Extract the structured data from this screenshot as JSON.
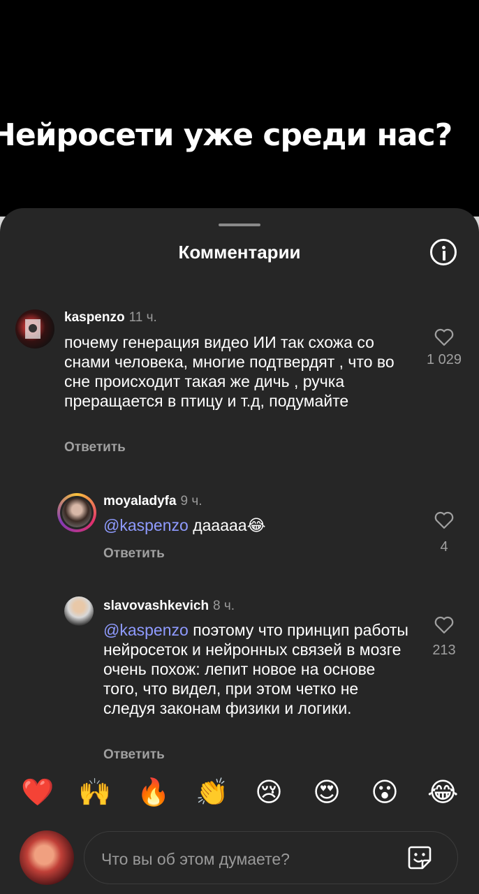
{
  "video": {
    "caption": "Нейросети уже среди нас?"
  },
  "sheet": {
    "title": "Комментарии",
    "info_icon": "info-icon"
  },
  "comments": [
    {
      "username": "kaspenzo",
      "time": "11 ч.",
      "text": "почему генерация видео ИИ так схожа со снами человека, многие подтвердят , что во сне происходит такая же дичь , ручка преращается в птицу и т.д, подумайте",
      "reply_label": "Ответить",
      "like_count": "1 029"
    },
    {
      "username": "moyaladyfa",
      "time": "9 ч.",
      "mention": "@kaspenzo",
      "text": " дааааа😂",
      "reply_label": "Ответить",
      "like_count": "4"
    },
    {
      "username": "slavovashkevich",
      "time": "8 ч.",
      "mention": "@kaspenzo",
      "text": " поэтому что принцип работы нейросеток и нейронных связей в мозге очень похож: лепит новое на основе того, что видел, при этом четко не следуя законам физики и логики.",
      "reply_label": "Ответить",
      "like_count": "213"
    }
  ],
  "reactions": [
    "❤️",
    "🙌",
    "🔥",
    "👏",
    "😢",
    "😍",
    "😮",
    "😂"
  ],
  "composer": {
    "placeholder": "Что вы об этом думаете?",
    "sticker_icon": "sticker-icon"
  },
  "colors": {
    "sheet_bg": "#262626",
    "mention": "#8f9bff",
    "muted": "#9a9a9a"
  }
}
